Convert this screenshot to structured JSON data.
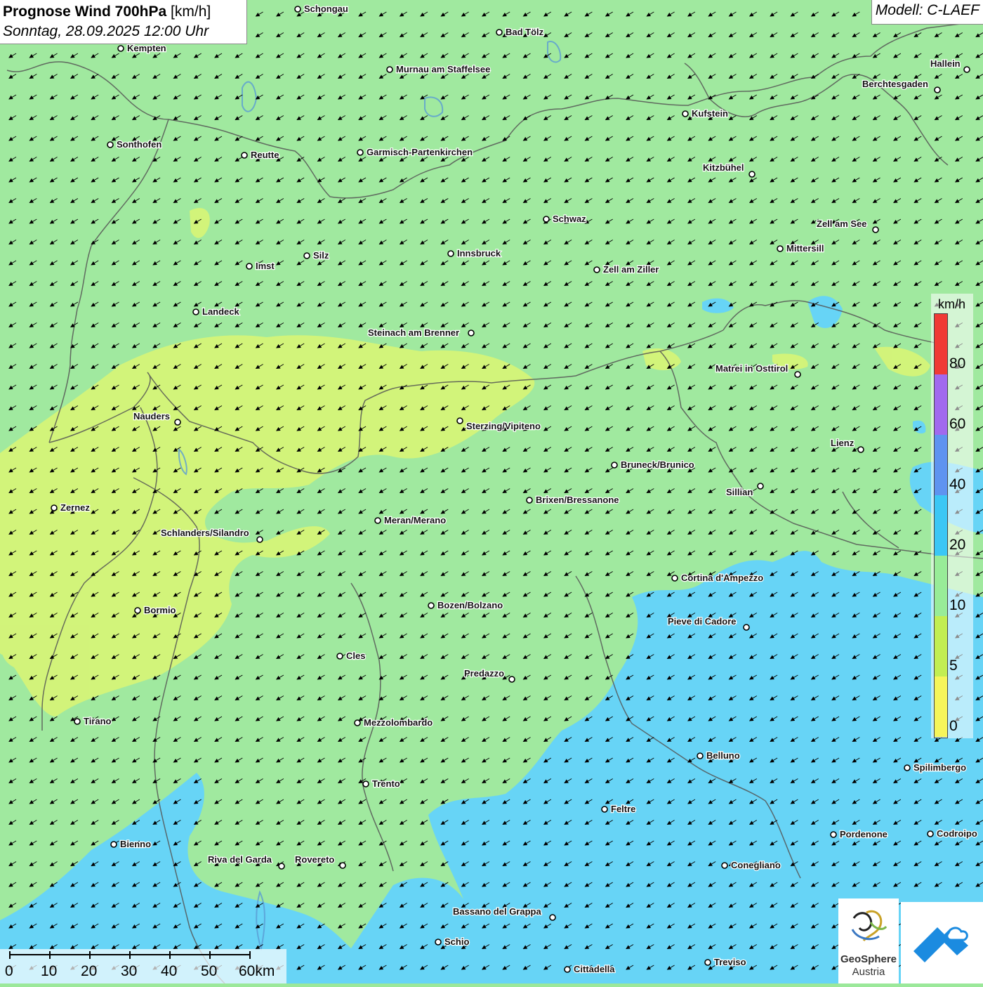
{
  "header": {
    "title_bold": "Prognose Wind 700hPa",
    "title_unit": " [km/h]",
    "datetime": "Sonntag, 28.09.2025 12:00 Uhr",
    "model": "Modell: C-LAEF"
  },
  "legend": {
    "unit": "km/h",
    "ticks": [
      "80",
      "60",
      "40",
      "20",
      "10",
      "5",
      "0"
    ],
    "colors": [
      "#f03a35",
      "#a169ee",
      "#5e93f0",
      "#3bc7f5",
      "#98ec98",
      "#c2ee52",
      "#f6f55a"
    ]
  },
  "scalebar": {
    "labels": [
      "0",
      "10",
      "20",
      "30",
      "40",
      "50",
      "60km"
    ]
  },
  "logos": {
    "geosphere_line1": "GeoSphere",
    "geosphere_line2": "Austria"
  },
  "colors": {
    "green": "#9be89a",
    "yellow_green": "#d6f56e",
    "blue": "#5ed2f6",
    "border": "#555555",
    "arrow": "#000000"
  },
  "wind": {
    "direction_to": "south-west",
    "description_hint": ""
  },
  "cities": [
    {
      "name": "Schongau"
    },
    {
      "name": "Bad Tölz"
    },
    {
      "name": "Kempten"
    },
    {
      "name": "Murnau am Staffelsee"
    },
    {
      "name": "Hallein"
    },
    {
      "name": "Berchtesgaden"
    },
    {
      "name": "Kufstein"
    },
    {
      "name": "Sonthofen"
    },
    {
      "name": "Reutte"
    },
    {
      "name": "Garmisch-Partenkirchen"
    },
    {
      "name": "Kitzbühel"
    },
    {
      "name": "Schwaz"
    },
    {
      "name": "Zell am See"
    },
    {
      "name": "Mittersill"
    },
    {
      "name": "Imst"
    },
    {
      "name": "Silz"
    },
    {
      "name": "Innsbruck"
    },
    {
      "name": "Zell am Ziller"
    },
    {
      "name": "Landeck"
    },
    {
      "name": "Steinach am Brenner"
    },
    {
      "name": "Matrei in Osttirol"
    },
    {
      "name": "Nauders"
    },
    {
      "name": "Sterzing/Vipiteno"
    },
    {
      "name": "Lienz"
    },
    {
      "name": "Bruneck/Brunico"
    },
    {
      "name": "Sillian"
    },
    {
      "name": "Zernez"
    },
    {
      "name": "Brixen/Bressanone"
    },
    {
      "name": "Meran/Merano"
    },
    {
      "name": "Schlanders/Silandro"
    },
    {
      "name": "Cortina d'Ampezzo"
    },
    {
      "name": "Bormio"
    },
    {
      "name": "Bozen/Bolzano"
    },
    {
      "name": "Pieve di Cadore"
    },
    {
      "name": "Cles"
    },
    {
      "name": "Predazzo"
    },
    {
      "name": "Tirano"
    },
    {
      "name": "Mezzolombardo"
    },
    {
      "name": "Belluno"
    },
    {
      "name": "Spilimbergo"
    },
    {
      "name": "Trento"
    },
    {
      "name": "Feltre"
    },
    {
      "name": "Pordenone"
    },
    {
      "name": "Codroipo"
    },
    {
      "name": "Bienno"
    },
    {
      "name": "Riva del Garda"
    },
    {
      "name": "Rovereto"
    },
    {
      "name": "Conegliano"
    },
    {
      "name": "Bassano del Grappa"
    },
    {
      "name": "Schio"
    },
    {
      "name": "Treviso"
    },
    {
      "name": "Cittadella"
    }
  ]
}
